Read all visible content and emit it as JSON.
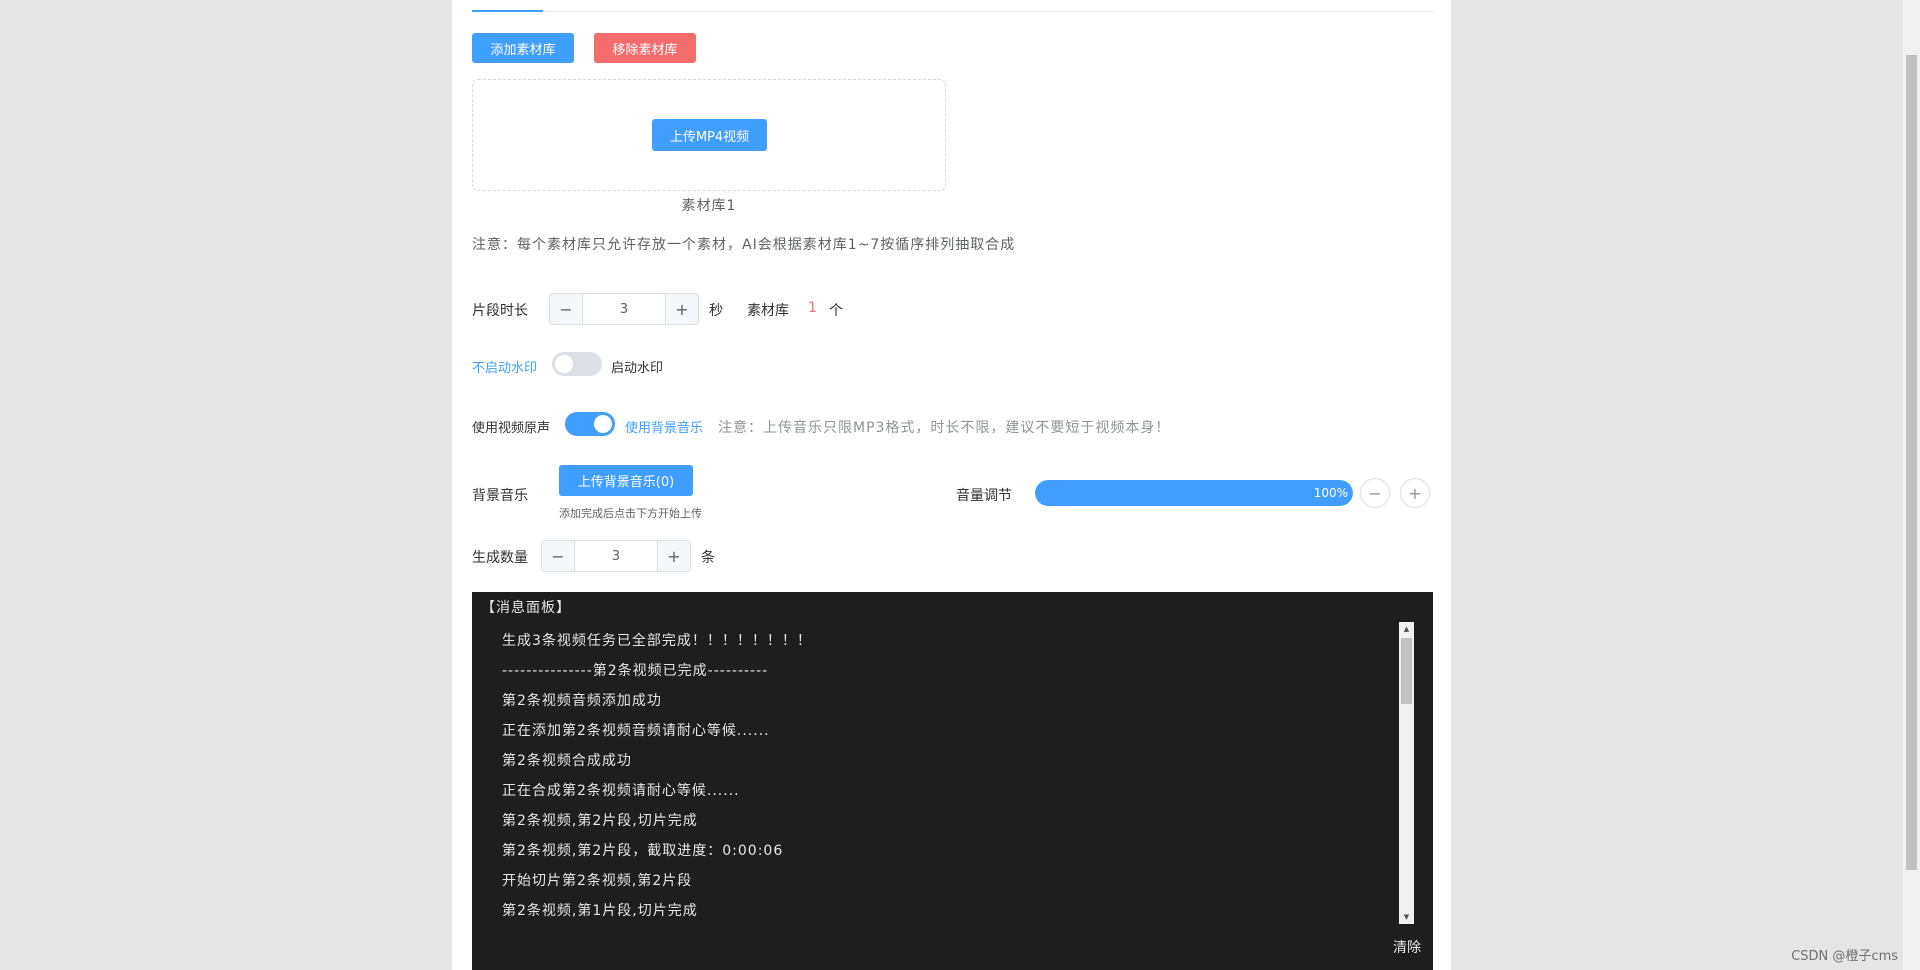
{
  "toolbar": {
    "add_library": "添加素材库",
    "remove_library": "移除素材库"
  },
  "upload": {
    "button": "上传MP4视频",
    "library_label": "素材库1"
  },
  "notice": "注意：每个素材库只允许存放一个素材，AI会根据素材库1~7按循序排列抽取合成",
  "segment": {
    "label": "片段时长",
    "value": "3",
    "unit": "秒",
    "library_label": "素材库",
    "library_count": "1",
    "library_unit": "个"
  },
  "watermark_switch": {
    "off_label": "不启动水印",
    "on_label": "启动水印",
    "enabled": false
  },
  "audio_switch": {
    "off_label": "使用视频原声",
    "on_label": "使用背景音乐",
    "enabled": true,
    "notice": "注意：上传音乐只限MP3格式，时长不限，建议不要短于视频本身！"
  },
  "bgm": {
    "label": "背景音乐",
    "button": "上传背景音乐(0)",
    "hint": "添加完成后点击下方开始上传"
  },
  "volume": {
    "label": "音量调节",
    "percent": 100,
    "text": "100%",
    "minus": "−",
    "plus": "+"
  },
  "generate": {
    "label": "生成数量",
    "value": "3",
    "unit": "条"
  },
  "stepper": {
    "minus": "−",
    "plus": "+"
  },
  "console": {
    "title": "【消息面板】",
    "lines": [
      "生成3条视频任务已全部完成！！！！！！！！",
      "---------------第2条视频已完成----------",
      "第2条视频音频添加成功",
      "正在添加第2条视频音频请耐心等候......",
      "第2条视频合成成功",
      "正在合成第2条视频请耐心等候......",
      "第2条视频,第2片段,切片完成",
      "第2条视频,第2片段，截取进度：0:00:06",
      "开始切片第2条视频,第2片段",
      "第2条视频,第1片段,切片完成"
    ],
    "clear": "清除"
  },
  "footer_watermark": "CSDN @橙子cms",
  "colors": {
    "primary": "#409eff",
    "danger": "#f56c6c",
    "console_bg": "#1e1e1e",
    "count_red": "#f56c6c"
  }
}
